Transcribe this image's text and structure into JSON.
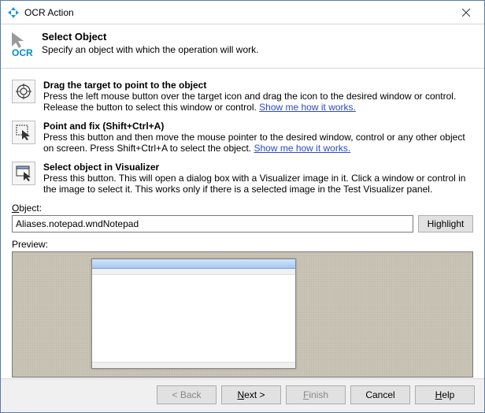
{
  "window": {
    "title": "OCR Action",
    "ocr_logo": "OCR"
  },
  "header": {
    "title": "Select Object",
    "subtitle": "Specify an object with which the operation will work."
  },
  "methods": {
    "drag": {
      "title": "Drag the target to point to the object",
      "desc_a": "Press the left mouse button over the target icon and drag the icon to the desired window or control. Release the button to select this window or control. ",
      "link": "Show me how it works."
    },
    "pointfix": {
      "title": "Point and fix (Shift+Ctrl+A)",
      "desc_a": "Press this button and then move the mouse pointer to the desired window, control or any other object on screen. Press Shift+Ctrl+A to select the object. ",
      "link": "Show me how it works."
    },
    "visualizer": {
      "title": "Select object in Visualizer",
      "desc": "Press this button. This will open a dialog box with a Visualizer image in it. Click a window or control in the image to select it. This works only if there is a selected image in the Test Visualizer panel."
    }
  },
  "object": {
    "label_prefix": "O",
    "label_rest": "bject:",
    "value": "Aliases.notepad.wndNotepad",
    "highlight": "Highlight"
  },
  "preview": {
    "label": "Preview:"
  },
  "buttons": {
    "back": "< Back",
    "next_pre": "N",
    "next_post": "ext >",
    "finish_pre": "F",
    "finish_post": "inish",
    "cancel": "Cancel",
    "help_pre": "H",
    "help_post": "elp"
  }
}
